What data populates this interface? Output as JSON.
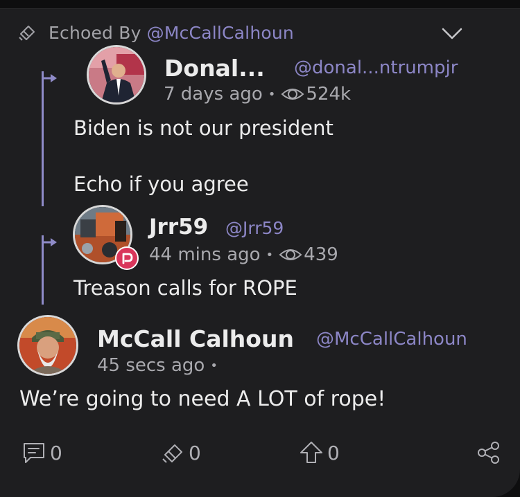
{
  "echoed": {
    "prefix": "Echoed By",
    "handle": "@McCallCalhoun"
  },
  "posts": [
    {
      "name": "Donal...",
      "handle": "@donal...ntrumpjr",
      "time": "7 days ago",
      "views": "524k",
      "text_line1": "Biden is not our president",
      "text_line2": "Echo if you agree"
    },
    {
      "name": "Jrr59",
      "handle": "@Jrr59",
      "time": "44 mins ago",
      "views": "439",
      "text_line1": "Treason calls for ROPE",
      "badge_letter": "P"
    },
    {
      "name": "McCall Calhoun",
      "handle": "@McCallCalhoun",
      "time": "45 secs ago",
      "text_line1": "We’re going to need A LOT of rope!"
    }
  ],
  "actions": {
    "comments": "0",
    "echoes": "0",
    "upvotes": "0"
  },
  "colors": {
    "accent": "#8c86c6",
    "thread": "#8f8bc8",
    "badge": "#d9365b",
    "background": "#1e1e20"
  },
  "icons": [
    "echo-icon",
    "chevron-down-icon",
    "eye-icon",
    "comment-icon",
    "upvote-icon",
    "share-icon",
    "parler-badge-icon"
  ]
}
